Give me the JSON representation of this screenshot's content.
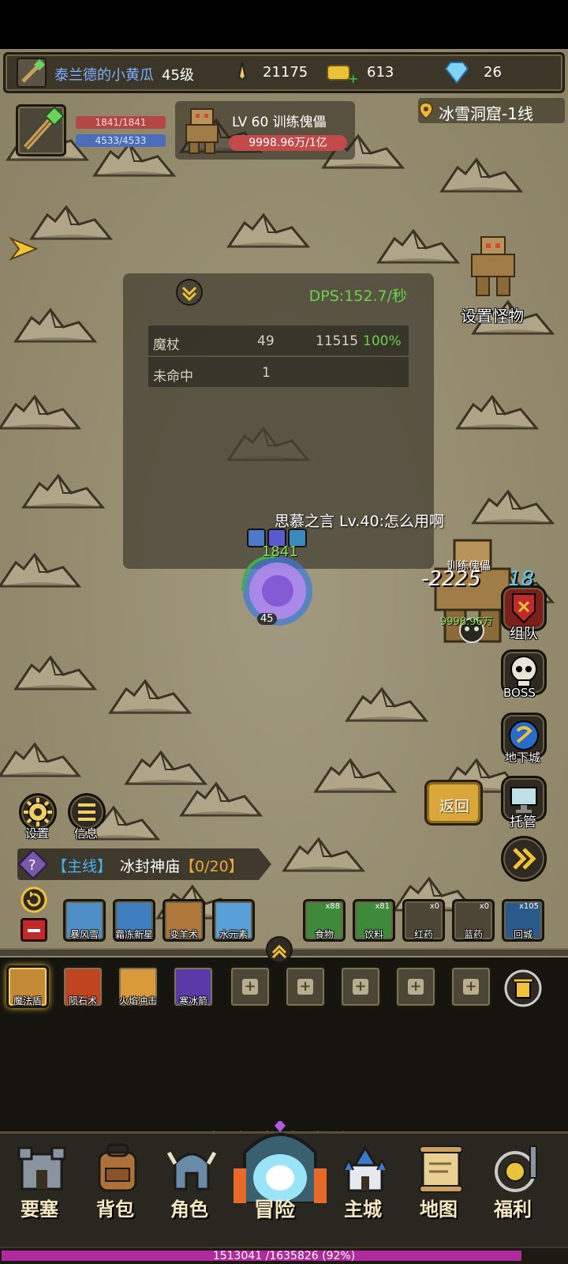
{
  "header": {
    "player_name": "泰兰德的小黄瓜",
    "level": "45级",
    "gold": "21175",
    "tickets": "613",
    "diamonds": "26"
  },
  "player": {
    "hp": "1841/1841",
    "mp": "4533/4533"
  },
  "target": {
    "name": "LV 60 训练傀儡",
    "hp": "9998.96万/1亿"
  },
  "location": "冰雪洞窟-1线",
  "set_monster_label": "设置怪物",
  "dps": {
    "title": "DPS:152.7/秒",
    "rows": [
      {
        "name": "魔杖",
        "hits": "49",
        "damage": "11515",
        "pct": "100%"
      },
      {
        "name": "未命中",
        "hits": "1",
        "damage": "",
        "pct": ""
      }
    ]
  },
  "chat": "思慕之言 Lv.40:怎么用啊",
  "battle": {
    "player_hp_float": "1841",
    "player_level_tag": "45",
    "monster_name": "训练傀儡",
    "damage_popup": "-2225",
    "damage_popup_2": "18",
    "monster_hp": "9998.96万"
  },
  "side_buttons": {
    "team": "组队",
    "boss": "BOSS",
    "dungeon": "地下城",
    "auto": "托管",
    "back": "返回"
  },
  "left_buttons": {
    "settings": "设置",
    "info": "信息"
  },
  "quest": {
    "type": "【主线】",
    "name": "冰封神庙",
    "progress": "【0/20】"
  },
  "skills_bar": [
    {
      "label": "暴风雪",
      "color": "#4f8fc8"
    },
    {
      "label": "霜冻新星",
      "color": "#3f7fc0"
    },
    {
      "label": "变羊术",
      "color": "#b0773a"
    },
    {
      "label": "水元素",
      "color": "#5aa0d8"
    }
  ],
  "items_bar": [
    {
      "label": "食物",
      "count": "x88",
      "color": "#3f8a3a"
    },
    {
      "label": "饮料",
      "count": "x81",
      "color": "#3f8a3a"
    },
    {
      "label": "红药",
      "count": "x0",
      "color": "#4c4637"
    },
    {
      "label": "蓝药",
      "count": "x0",
      "color": "#4c4637"
    },
    {
      "label": "回城",
      "count": "x105",
      "color": "#2a5a8a"
    }
  ],
  "equipped_skills": [
    {
      "label": "魔法盾",
      "color": "#c58a38"
    },
    {
      "label": "陨石术",
      "color": "#c0441f"
    },
    {
      "label": "火焰冲击",
      "color": "#d89a3a"
    },
    {
      "label": "寒冰箭",
      "color": "#5a3aa8"
    }
  ],
  "nav": [
    {
      "label": "要塞"
    },
    {
      "label": "背包"
    },
    {
      "label": "角色"
    },
    {
      "label": "冒险"
    },
    {
      "label": "主城"
    },
    {
      "label": "地图"
    },
    {
      "label": "福利"
    }
  ],
  "xp": {
    "text": "1513041 /1635826 (92%)",
    "progress": 0.92
  },
  "colors": {
    "gems": [
      "#4caa54",
      "#d43a3a",
      "#e8d43a",
      "#e88a2a",
      "#3aa8e8",
      "#a83ad4"
    ]
  }
}
